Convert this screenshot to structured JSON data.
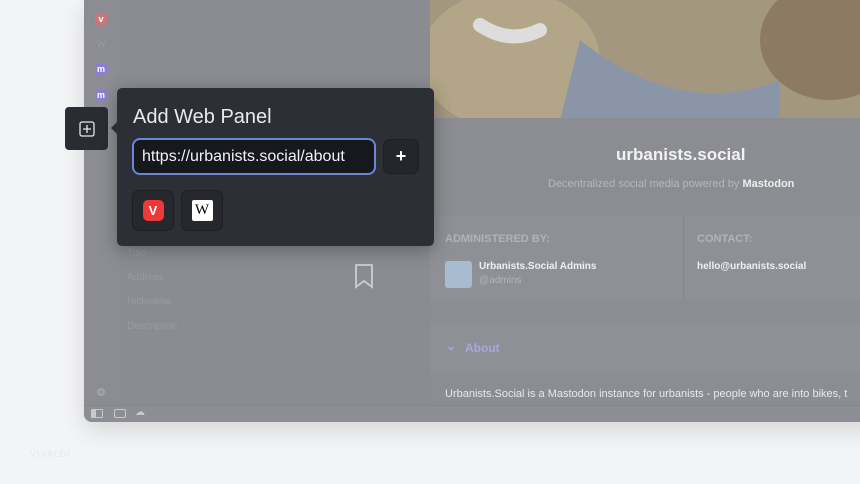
{
  "popup": {
    "title": "Add Web Panel",
    "url_value": "https://urbanists.social/about",
    "add_label": "+",
    "suggestions": [
      {
        "name": "Vivaldi",
        "glyph": "V"
      },
      {
        "name": "Wikipedia",
        "glyph": "W"
      }
    ]
  },
  "panel_fields": [
    "Title",
    "Address",
    "Nickname",
    "Description"
  ],
  "site": {
    "title": "urbanists.social",
    "subtitle": "Decentralized social media powered by",
    "subtitle_brand": "Mastodon",
    "admin_label": "ADMINISTERED BY:",
    "admin_name": "Urbanists.Social Admins",
    "admin_handle": "@admins",
    "contact_label": "CONTACT:",
    "contact_email": "hello@urbanists.social",
    "about_label": "About",
    "about_text": "Urbanists.Social is a Mastodon instance for urbanists - people who are into bikes, t"
  },
  "strip": {
    "w": "W",
    "m": "m"
  },
  "watermark": "VIVALDI",
  "colors": {
    "accent": "#6a88d6",
    "popup_bg": "#2d2f36",
    "vivaldi": "#ef3939",
    "mastodon": "#6364ff"
  }
}
